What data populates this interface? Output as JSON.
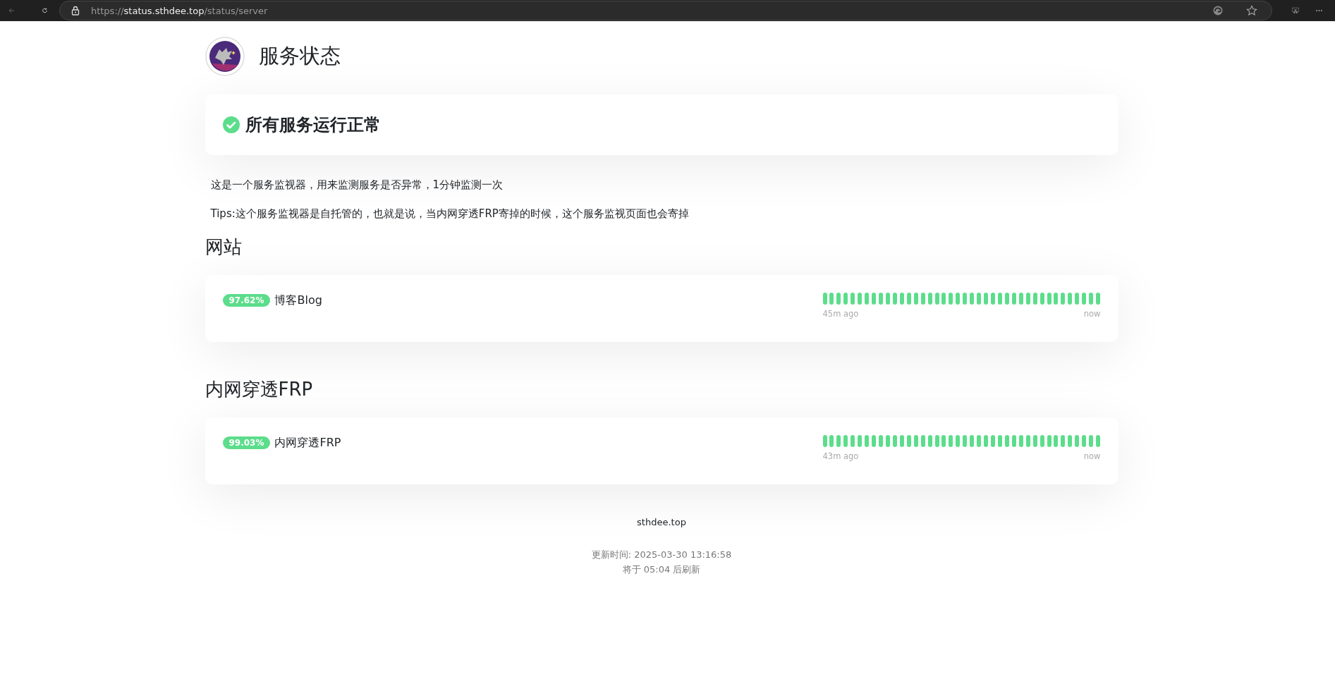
{
  "browser": {
    "url_prefix": "https://",
    "url_host": "status.sthdee.top",
    "url_path": "/status/server"
  },
  "header": {
    "title": "服务状态"
  },
  "overall": {
    "all_ok": true,
    "text": "所有服务运行正常"
  },
  "description": [
    "这是一个服务监视器，用来监测服务是否异常，1分钟监测一次",
    "Tips:这个服务监视器是自托管的，也就是说，当内网穿透FRP寄掉的时候，这个服务监视页面也会寄掉"
  ],
  "groups": [
    {
      "title": "网站",
      "monitors": [
        {
          "uptime": "97.62%",
          "name": "博客Blog",
          "beats": [
            {
              "up": true
            },
            {
              "up": true
            },
            {
              "up": true
            },
            {
              "up": true
            },
            {
              "up": true
            },
            {
              "up": true
            },
            {
              "up": true
            },
            {
              "up": true
            },
            {
              "up": true
            },
            {
              "up": true
            },
            {
              "up": true
            },
            {
              "up": true
            },
            {
              "up": true
            },
            {
              "up": true
            },
            {
              "up": true
            },
            {
              "up": true
            },
            {
              "up": true
            },
            {
              "up": true
            },
            {
              "up": true
            },
            {
              "up": true
            },
            {
              "up": true
            },
            {
              "up": true
            },
            {
              "up": true
            },
            {
              "up": true
            },
            {
              "up": true
            },
            {
              "up": true
            },
            {
              "up": true
            },
            {
              "up": true
            },
            {
              "up": true
            },
            {
              "up": true
            },
            {
              "up": true
            },
            {
              "up": true
            },
            {
              "up": true
            },
            {
              "up": true
            },
            {
              "up": true
            },
            {
              "up": true
            },
            {
              "up": true
            },
            {
              "up": true
            },
            {
              "up": true
            },
            {
              "up": true
            }
          ],
          "start_label": "45m ago",
          "end_label": "now"
        }
      ]
    },
    {
      "title": "内网穿透FRP",
      "monitors": [
        {
          "uptime": "99.03%",
          "name": "内网穿透FRP",
          "beats": [
            {
              "up": true
            },
            {
              "up": true
            },
            {
              "up": true
            },
            {
              "up": true
            },
            {
              "up": true
            },
            {
              "up": true
            },
            {
              "up": true
            },
            {
              "up": true
            },
            {
              "up": true
            },
            {
              "up": true
            },
            {
              "up": true
            },
            {
              "up": true
            },
            {
              "up": true
            },
            {
              "up": true
            },
            {
              "up": true
            },
            {
              "up": true
            },
            {
              "up": true
            },
            {
              "up": true
            },
            {
              "up": true
            },
            {
              "up": true
            },
            {
              "up": true
            },
            {
              "up": true
            },
            {
              "up": true
            },
            {
              "up": true
            },
            {
              "up": true
            },
            {
              "up": true
            },
            {
              "up": true
            },
            {
              "up": true
            },
            {
              "up": true
            },
            {
              "up": true
            },
            {
              "up": true
            },
            {
              "up": true
            },
            {
              "up": true
            },
            {
              "up": true
            },
            {
              "up": true
            },
            {
              "up": true
            },
            {
              "up": true
            },
            {
              "up": true
            },
            {
              "up": true
            },
            {
              "up": true
            }
          ],
          "start_label": "43m ago",
          "end_label": "now"
        }
      ]
    }
  ],
  "footer": {
    "site": "sthdee.top",
    "updated": "更新时间: 2025-03-30 13:16:58",
    "refresh": "将于 05:04 后刷新"
  }
}
